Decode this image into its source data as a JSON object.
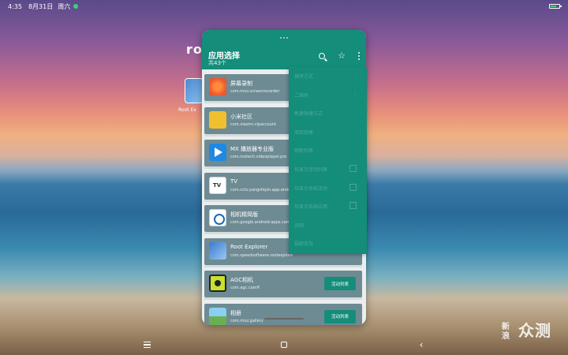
{
  "status_bar": {
    "time": "4:35",
    "date": "8月31日",
    "weekday": "周六"
  },
  "background": {
    "partial_title": "roo",
    "app_label": "Root Ex"
  },
  "app": {
    "title": "应用选择",
    "subtitle": "共43个",
    "apps": [
      {
        "name": "屏幕录制",
        "package": "com.miui.screenrecorder",
        "icon": "screen-recorder-icon"
      },
      {
        "name": "小米社区",
        "package": "com.xiaomi.vipaccount",
        "icon": "community-icon"
      },
      {
        "name": "MX 播放器专业版",
        "package": "com.mxtech.videoplayer.pro",
        "icon": "mx-player-icon"
      },
      {
        "name": "TV",
        "package": "com.cctv.yangshipin.app.androi",
        "icon": "tv-icon"
      },
      {
        "name": "相机精简版",
        "package": "com.google.android.apps.camera",
        "icon": "camera-lite-icon"
      },
      {
        "name": "Root Explorer",
        "package": "com.speedsoftware.rootexplore",
        "icon": "root-explorer-icon"
      },
      {
        "name": "AGC相机",
        "package": "com.agc.camff",
        "icon": "agc-camera-icon",
        "action": "活动列表"
      },
      {
        "name": "相册",
        "package": "com.miui.gallery",
        "icon": "gallery-icon",
        "action": "活动列表"
      }
    ]
  },
  "menu": {
    "items": [
      {
        "label": "排序方式",
        "type": "submenu",
        "arrow": "›"
      },
      {
        "label": "二维码",
        "type": "submenu",
        "arrow": "›"
      },
      {
        "label": "新建快捷方式",
        "type": "plain"
      },
      {
        "label": "添加到桌",
        "type": "plain"
      },
      {
        "label": "刷新列表",
        "type": "plain"
      },
      {
        "label": "仅显示活动列表",
        "type": "check"
      },
      {
        "label": "仅显示系统活动",
        "type": "check"
      },
      {
        "label": "仅显示系统应用",
        "type": "check"
      },
      {
        "label": "说明",
        "type": "plain"
      },
      {
        "label": "捐助支持",
        "type": "plain"
      }
    ]
  },
  "watermark": {
    "text": "新浪众测",
    "small": "新浪",
    "large": "众测"
  },
  "colors": {
    "accent": "#148d7a",
    "row_bg": "#6e8b94"
  }
}
